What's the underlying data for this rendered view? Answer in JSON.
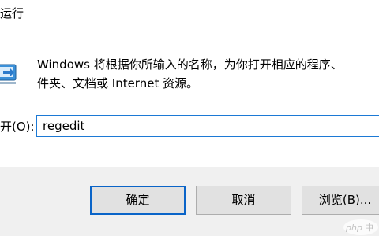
{
  "window": {
    "title": "运行"
  },
  "dialog": {
    "description": "Windows 将根据你所输入的名称，为你打开相应的程序、\n件夹、文档或 Internet 资源。",
    "open_label": "开(O):",
    "input_value": "regedit"
  },
  "buttons": {
    "ok_label": "确定",
    "cancel_label": "取消",
    "browse_label": "浏览(B)..."
  },
  "watermark": {
    "text": "php中"
  },
  "icons": {
    "run": "run-dialog-icon"
  },
  "colors": {
    "focus_border": "#1c79d5",
    "default_button_border": "#0a64c8",
    "footer_bg": "#f0f0f0"
  }
}
